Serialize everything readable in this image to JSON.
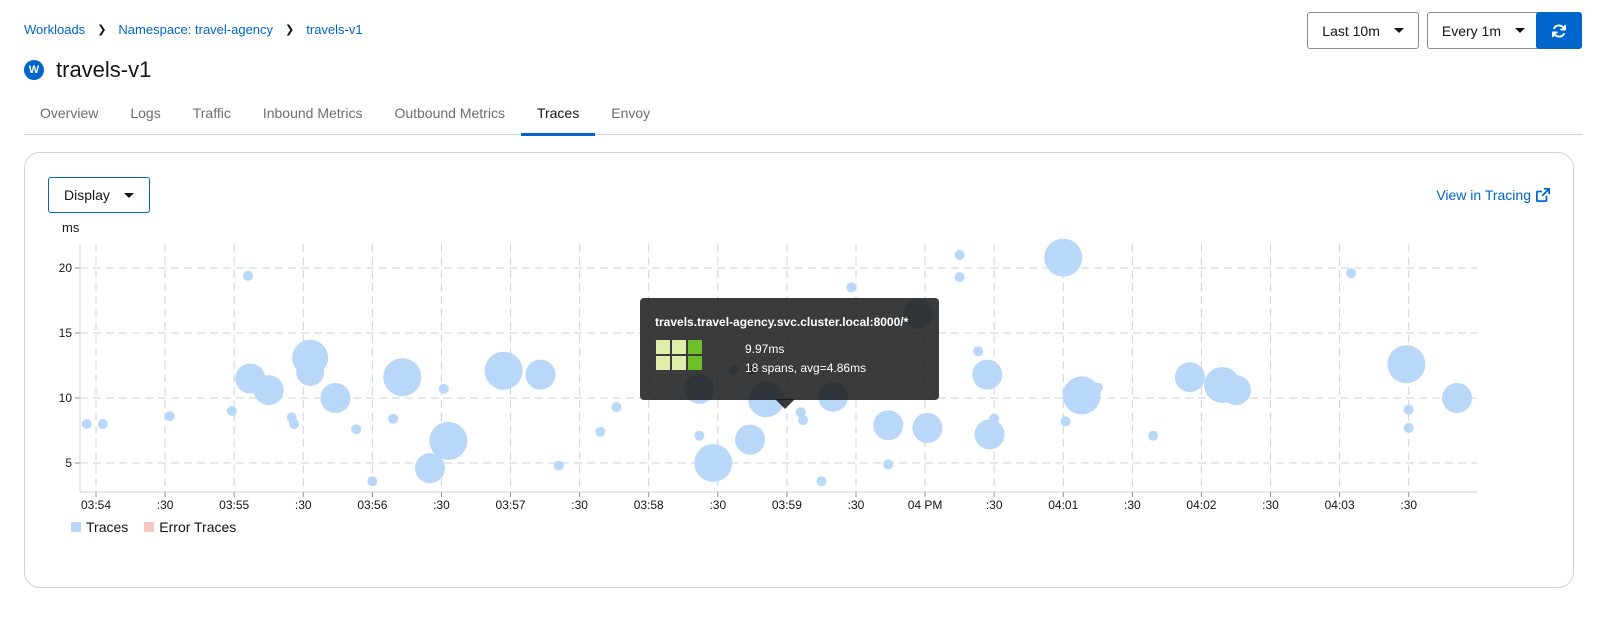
{
  "breadcrumb": {
    "items": [
      "Workloads",
      "Namespace: travel-agency",
      "travels-v1"
    ]
  },
  "title": {
    "badge": "W",
    "text": "travels-v1"
  },
  "controls": {
    "time_range": "Last 10m",
    "refresh_interval": "Every 1m",
    "refresh_icon": "sync-icon"
  },
  "tabs": [
    {
      "label": "Overview"
    },
    {
      "label": "Logs"
    },
    {
      "label": "Traffic"
    },
    {
      "label": "Inbound Metrics"
    },
    {
      "label": "Outbound Metrics"
    },
    {
      "label": "Traces",
      "active": true
    },
    {
      "label": "Envoy"
    }
  ],
  "card": {
    "display_label": "Display",
    "view_in_tracing": "View in Tracing"
  },
  "tooltip": {
    "title": "travels.travel-agency.svc.cluster.local:8000/*",
    "line1": "9.97ms",
    "line2": "18 spans, avg=4.86ms",
    "cells": [
      "#e0eeab",
      "#e0eeab",
      "#6ec02a",
      "#e0eeab",
      "#e0eeab",
      "#6ec02a"
    ]
  },
  "chart_data": {
    "type": "scatter",
    "ylabel": "ms",
    "ylim": [
      3,
      22
    ],
    "yticks": [
      5,
      10,
      15,
      20
    ],
    "xlim": [
      0,
      605
    ],
    "xticks": [
      {
        "t": 0,
        "label": "03:54"
      },
      {
        "t": 30,
        "label": ":30"
      },
      {
        "t": 60,
        "label": "03:55"
      },
      {
        "t": 90,
        "label": ":30"
      },
      {
        "t": 120,
        "label": "03:56"
      },
      {
        "t": 150,
        "label": ":30"
      },
      {
        "t": 180,
        "label": "03:57"
      },
      {
        "t": 210,
        "label": ":30"
      },
      {
        "t": 240,
        "label": "03:58"
      },
      {
        "t": 270,
        "label": ":30"
      },
      {
        "t": 300,
        "label": "03:59"
      },
      {
        "t": 330,
        "label": ":30"
      },
      {
        "t": 360,
        "label": "04 PM"
      },
      {
        "t": 390,
        "label": ":30"
      },
      {
        "t": 420,
        "label": "04:01"
      },
      {
        "t": 450,
        "label": ":30"
      },
      {
        "t": 480,
        "label": "04:02"
      },
      {
        "t": 510,
        "label": ":30"
      },
      {
        "t": 540,
        "label": "04:03"
      },
      {
        "t": 570,
        "label": ":30"
      }
    ],
    "legend": [
      {
        "label": "Traces",
        "color": "#b8d7f9"
      },
      {
        "label": "Error Traces",
        "color": "#f5c7c2"
      }
    ],
    "series": [
      {
        "name": "Traces",
        "color": "#b8d7f9",
        "points": [
          {
            "t": -4,
            "y": 8.0,
            "r": 5
          },
          {
            "t": 3,
            "y": 8.0,
            "r": 5
          },
          {
            "t": 32,
            "y": 8.6,
            "r": 5
          },
          {
            "t": 66,
            "y": 19.4,
            "r": 5
          },
          {
            "t": 59,
            "y": 9.0,
            "r": 5
          },
          {
            "t": 67,
            "y": 11.5,
            "r": 15
          },
          {
            "t": 75,
            "y": 10.6,
            "r": 15
          },
          {
            "t": 85,
            "y": 8.5,
            "r": 5
          },
          {
            "t": 86,
            "y": 8.0,
            "r": 5
          },
          {
            "t": 93,
            "y": 13.1,
            "r": 18
          },
          {
            "t": 93,
            "y": 12.0,
            "r": 14
          },
          {
            "t": 104,
            "y": 10.0,
            "r": 15
          },
          {
            "t": 113,
            "y": 7.6,
            "r": 5
          },
          {
            "t": 120,
            "y": 3.6,
            "r": 5
          },
          {
            "t": 129,
            "y": 8.4,
            "r": 5
          },
          {
            "t": 133,
            "y": 11.6,
            "r": 19
          },
          {
            "t": 145,
            "y": 4.6,
            "r": 15
          },
          {
            "t": 151,
            "y": 10.7,
            "r": 5
          },
          {
            "t": 153,
            "y": 6.7,
            "r": 19
          },
          {
            "t": 171,
            "y": 12.3,
            "r": 5
          },
          {
            "t": 177,
            "y": 12.1,
            "r": 19
          },
          {
            "t": 193,
            "y": 11.8,
            "r": 15
          },
          {
            "t": 201,
            "y": 4.8,
            "r": 5
          },
          {
            "t": 219,
            "y": 7.4,
            "r": 5
          },
          {
            "t": 226,
            "y": 9.3,
            "r": 5
          },
          {
            "t": 262,
            "y": 10.7,
            "r": 15
          },
          {
            "t": 262,
            "y": 7.1,
            "r": 5
          },
          {
            "t": 268,
            "y": 5.0,
            "r": 19
          },
          {
            "t": 277,
            "y": 12.2,
            "r": 5
          },
          {
            "t": 284,
            "y": 6.8,
            "r": 15
          },
          {
            "t": 291,
            "y": 9.9,
            "r": 18
          },
          {
            "t": 306,
            "y": 8.9,
            "r": 5
          },
          {
            "t": 307,
            "y": 8.3,
            "r": 5
          },
          {
            "t": 315,
            "y": 3.6,
            "r": 5
          },
          {
            "t": 320,
            "y": 10.1,
            "r": 15
          },
          {
            "t": 328,
            "y": 18.5,
            "r": 5
          },
          {
            "t": 344,
            "y": 4.9,
            "r": 5
          },
          {
            "t": 344,
            "y": 7.9,
            "r": 15
          },
          {
            "t": 357,
            "y": 16.5,
            "r": 15
          },
          {
            "t": 361,
            "y": 7.7,
            "r": 15
          },
          {
            "t": 375,
            "y": 21.0,
            "r": 5
          },
          {
            "t": 375,
            "y": 19.3,
            "r": 5
          },
          {
            "t": 383,
            "y": 13.6,
            "r": 5
          },
          {
            "t": 387,
            "y": 11.8,
            "r": 15
          },
          {
            "t": 388,
            "y": 7.2,
            "r": 15
          },
          {
            "t": 390,
            "y": 8.4,
            "r": 5
          },
          {
            "t": 421,
            "y": 8.2,
            "r": 5
          },
          {
            "t": 420,
            "y": 20.8,
            "r": 19
          },
          {
            "t": 428,
            "y": 10.2,
            "r": 19
          },
          {
            "t": 435,
            "y": 10.8,
            "r": 5
          },
          {
            "t": 459,
            "y": 7.1,
            "r": 5
          },
          {
            "t": 475,
            "y": 11.6,
            "r": 15
          },
          {
            "t": 489,
            "y": 11.0,
            "r": 18
          },
          {
            "t": 495,
            "y": 10.6,
            "r": 15
          },
          {
            "t": 545,
            "y": 19.6,
            "r": 5
          },
          {
            "t": 569,
            "y": 12.6,
            "r": 19
          },
          {
            "t": 570,
            "y": 9.1,
            "r": 5
          },
          {
            "t": 570,
            "y": 7.7,
            "r": 5
          },
          {
            "t": 591,
            "y": 10.0,
            "r": 15
          }
        ]
      }
    ],
    "highlighted": [
      {
        "t": 285,
        "y": 12.2,
        "r": 5,
        "color": "#7f8a99"
      }
    ]
  }
}
